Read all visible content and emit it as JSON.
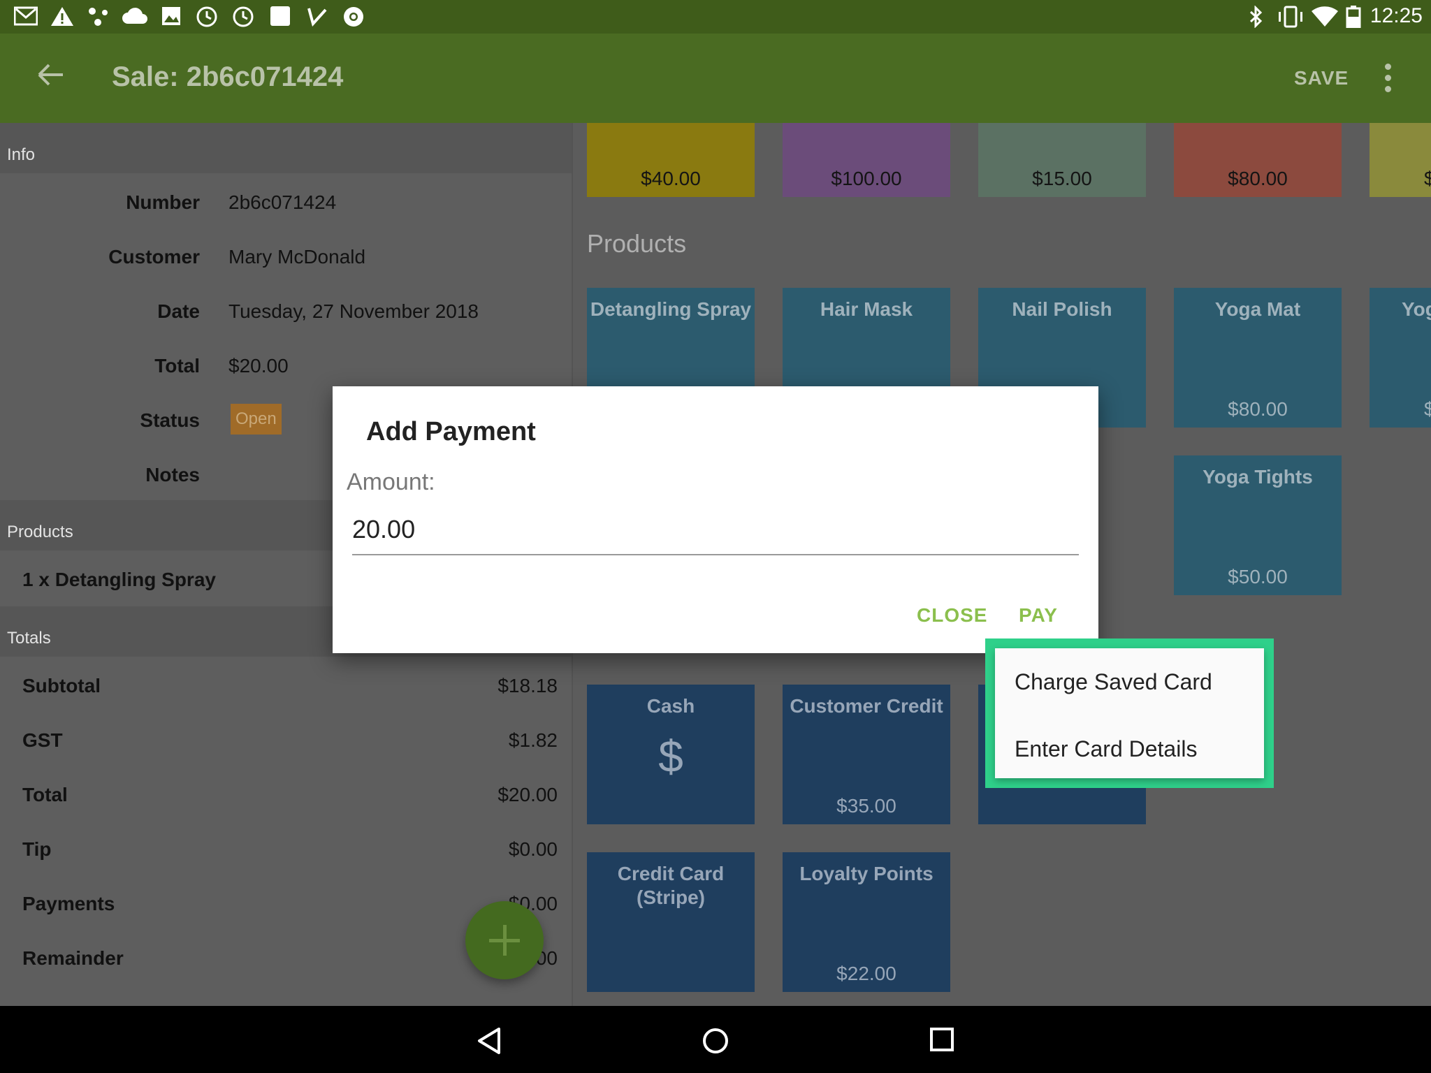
{
  "status_bar": {
    "time": "12:25",
    "left_icons": [
      "gmail-icon",
      "warning-icon",
      "share-icon",
      "cloud-icon",
      "image-icon",
      "clock-icon",
      "clock-icon",
      "square-icon",
      "check-icon",
      "chrome-icon"
    ],
    "right_icons": [
      "bluetooth-icon",
      "vibrate-icon",
      "wifi-icon",
      "battery-icon"
    ]
  },
  "toolbar": {
    "title": "Sale: 2b6c071424",
    "save_label": "SAVE"
  },
  "info": {
    "header": "Info",
    "number_label": "Number",
    "number": "2b6c071424",
    "customer_label": "Customer",
    "customer": "Mary McDonald",
    "date_label": "Date",
    "date": "Tuesday, 27 November 2018",
    "total_label": "Total",
    "total": "$20.00",
    "status_label": "Status",
    "status": "Open",
    "notes_label": "Notes"
  },
  "products_section": {
    "header": "Products",
    "items": [
      "1 x Detangling Spray"
    ]
  },
  "totals": {
    "header": "Totals",
    "rows": [
      {
        "label": "Subtotal",
        "value": "$18.18"
      },
      {
        "label": "GST",
        "value": "$1.82"
      },
      {
        "label": "Total",
        "value": "$20.00"
      },
      {
        "label": "Tip",
        "value": "$0.00"
      },
      {
        "label": "Payments",
        "value": "$0.00"
      },
      {
        "label": "Remainder",
        "value": "$20.00"
      }
    ]
  },
  "gift_tiles": [
    {
      "price": "$40.00",
      "color": "#8a7a10"
    },
    {
      "price": "$100.00",
      "color": "#6b4c7a"
    },
    {
      "price": "$15.00",
      "color": "#5b7163"
    },
    {
      "price": "$80.00",
      "color": "#8c4a3e"
    },
    {
      "price": "$",
      "color": "#8a8a3c"
    }
  ],
  "products_grid": {
    "header": "Products",
    "tiles": [
      {
        "name": "Detangling Spray",
        "price": ""
      },
      {
        "name": "Hair Mask",
        "price": ""
      },
      {
        "name": "Nail Polish",
        "price": ""
      },
      {
        "name": "Yoga Mat",
        "price": "$80.00"
      },
      {
        "name": "Yog",
        "price": "$"
      },
      {
        "name": "Yoga Tights",
        "price": "$50.00"
      }
    ],
    "color": "#2c5b6e"
  },
  "payment_grid": {
    "tiles": [
      {
        "name": "Cash",
        "price": "",
        "symbol": "$"
      },
      {
        "name": "Customer Credit",
        "price": "$35.00"
      },
      {
        "name": "",
        "price": ""
      },
      {
        "name": "Credit Card (Stripe)",
        "price": ""
      },
      {
        "name": "Loyalty Points",
        "price": "$22.00"
      }
    ],
    "color": "#1f3e5e"
  },
  "dialog": {
    "title": "Add Payment",
    "amount_label": "Amount:",
    "amount_value": "20.00",
    "close_label": "CLOSE",
    "pay_label": "PAY",
    "accent": "#8bbf4d"
  },
  "pay_menu": {
    "items": [
      "Charge Saved Card",
      "Enter Card Details"
    ],
    "highlight": "#2fd08a"
  },
  "nav_bar": {
    "icons": [
      "back-triangle-icon",
      "home-circle-icon",
      "recent-square-icon"
    ]
  }
}
